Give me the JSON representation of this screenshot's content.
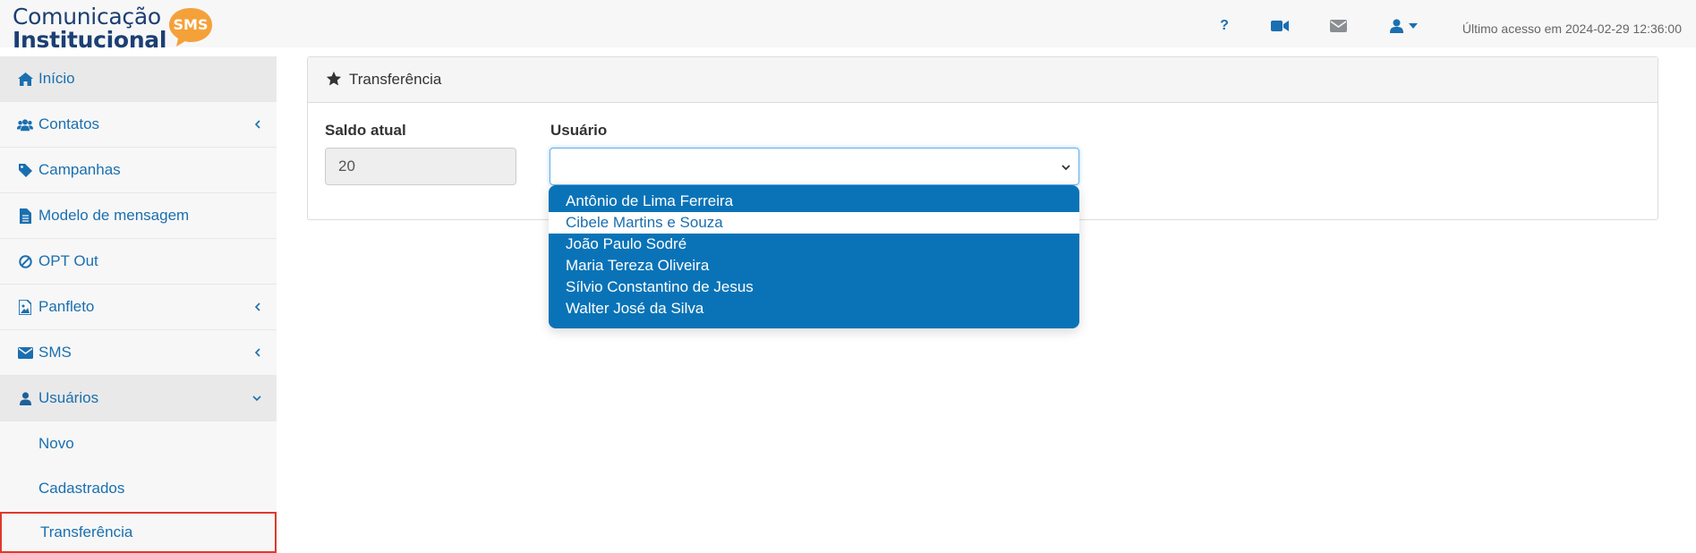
{
  "logo": {
    "line1": "Comunicação",
    "line2": "Institucional",
    "badge": "SMS",
    "colors": {
      "text": "#1c3f73",
      "badge": "#f5a13a"
    }
  },
  "header": {
    "icons": [
      "question-icon",
      "video-camera-icon",
      "envelope-icon",
      "user-icon",
      "caret-down-icon"
    ],
    "help_label": "?",
    "last_access": "Último acesso em 2024-02-29 12:36:00"
  },
  "sidebar": {
    "items": [
      {
        "label": "Início",
        "icon": "home-icon",
        "active": true
      },
      {
        "label": "Contatos",
        "icon": "users-icon",
        "chevron": "left"
      },
      {
        "label": "Campanhas",
        "icon": "tag-icon"
      },
      {
        "label": "Modelo de mensagem",
        "icon": "file-text-icon"
      },
      {
        "label": "OPT Out",
        "icon": "ban-icon"
      },
      {
        "label": "Panfleto",
        "icon": "image-icon",
        "chevron": "left"
      },
      {
        "label": "SMS",
        "icon": "envelope-icon",
        "chevron": "left"
      },
      {
        "label": "Usuários",
        "icon": "user-icon",
        "chevron": "down",
        "expanded": true
      }
    ],
    "sub_items": [
      {
        "label": "Novo"
      },
      {
        "label": "Cadastrados"
      },
      {
        "label": "Transferência",
        "selected": true
      }
    ]
  },
  "panel": {
    "title": "Transferência",
    "icon": "star-icon",
    "saldo_label": "Saldo atual",
    "saldo_value": "20",
    "usuario_label": "Usuário",
    "usuario_value": ""
  },
  "dropdown": {
    "options": [
      "Antônio de Lima Ferreira",
      "Cibele Martins e Souza",
      "João Paulo Sodré",
      "Maria Tereza Oliveira",
      "Sílvio Constantino de Jesus",
      "Walter José da Silva"
    ],
    "hovered_index": 1
  },
  "colors": {
    "accent": "#1a6fb0",
    "dropdown_bg": "#0a73b7",
    "selected_outline": "#e0392b"
  }
}
